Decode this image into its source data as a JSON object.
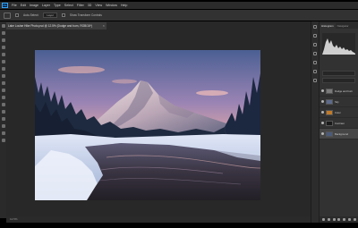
{
  "menubar": {
    "app_icon": "Ps",
    "items": [
      "File",
      "Edit",
      "Image",
      "Layer",
      "Type",
      "Select",
      "Filter",
      "3D",
      "View",
      "Window",
      "Help"
    ]
  },
  "options": {
    "tool_icon": "move-tool-icon",
    "auto_select_label": "Auto-Select:",
    "auto_select_value": "Layer",
    "transform_label": "Show Transform Controls"
  },
  "document": {
    "tab_title": "Lake Louise Hike Photo.psd @ 12.5% (Dodge and burn, RGB/16*)"
  },
  "status": {
    "zoom": "12.5%"
  },
  "panels": {
    "tabs": [
      "Histogram",
      "Navigator"
    ]
  },
  "layers": [
    {
      "name": "Dodge and burn",
      "thumb": "#7a7a7a",
      "selected": false
    },
    {
      "name": "Sky",
      "thumb": "#5d6a8a",
      "selected": false
    },
    {
      "name": "Color",
      "thumb": "#c07a2a",
      "selected": false
    },
    {
      "name": "Contrast",
      "thumb": "#1a1a1a",
      "selected": false
    },
    {
      "name": "Background",
      "thumb": "#4a5a7a",
      "selected": true
    }
  ],
  "colors": {
    "accent": "#31a8ff",
    "panel": "#323232",
    "canvas_bg": "#282828"
  }
}
